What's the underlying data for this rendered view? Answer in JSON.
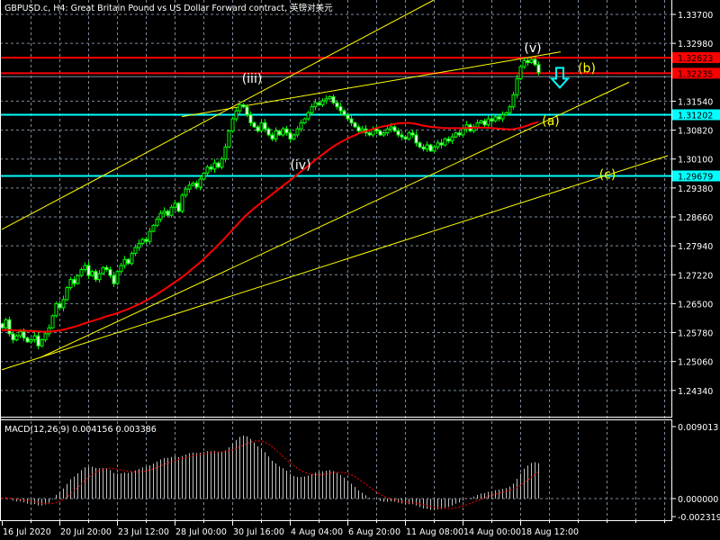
{
  "title": "GBPUSD.c, H4:  Great Britain Pound vs US Dollar Forward contract, 英镑对美元",
  "colors": {
    "background": "#000000",
    "bull": "#00ff00",
    "ma": "#ff0000",
    "trend": "#ffff00",
    "support": "#00ffff",
    "resistance": "#ff0000",
    "grid": "#7a8a9a",
    "macd_hist": "#c0c0c0",
    "macd_signal": "#ff0000"
  },
  "chart_data": {
    "type": "candlestick",
    "symbol": "GBPUSD.c",
    "timeframe": "H4",
    "ylim": [
      1.23687,
      1.34058
    ],
    "y_ticks": [
      "1.33700",
      "1.32980",
      "1.31540",
      "1.30820",
      "1.30100",
      "1.29380",
      "1.28660",
      "1.27940",
      "1.27220",
      "1.26500",
      "1.25780",
      "1.25060",
      "1.24340"
    ],
    "x_ticks": [
      {
        "bar": 0,
        "label": "16 Jul 2020"
      },
      {
        "bar": 16,
        "label": "20 Jul 20:00"
      },
      {
        "bar": 32,
        "label": "23 Jul 12:00"
      },
      {
        "bar": 48,
        "label": "28 Jul 00:00"
      },
      {
        "bar": 64,
        "label": "30 Jul 16:00"
      },
      {
        "bar": 80,
        "label": "4 Aug 04:00"
      },
      {
        "bar": 96,
        "label": "6 Aug 20:00"
      },
      {
        "bar": 112,
        "label": "11 Aug 08:00"
      },
      {
        "bar": 128,
        "label": "14 Aug 00:00"
      },
      {
        "bar": 144,
        "label": "18 Aug 12:00"
      }
    ],
    "closes": [
      1.259,
      1.261,
      1.2575,
      1.256,
      1.257,
      1.258,
      1.2565,
      1.2555,
      1.256,
      1.257,
      1.2545,
      1.256,
      1.2575,
      1.259,
      1.262,
      1.265,
      1.264,
      1.266,
      1.269,
      1.271,
      1.27,
      1.272,
      1.2735,
      1.2745,
      1.272,
      1.273,
      1.271,
      1.2725,
      1.274,
      1.2735,
      1.272,
      1.27,
      1.273,
      1.2745,
      1.276,
      1.275,
      1.2775,
      1.279,
      1.28,
      1.281,
      1.2805,
      1.283,
      1.2845,
      1.286,
      1.2875,
      1.288,
      1.287,
      1.289,
      1.29,
      1.288,
      1.292,
      1.2935,
      1.2945,
      1.295,
      1.294,
      1.296,
      1.2975,
      1.299,
      1.2985,
      1.3,
      1.299,
      1.301,
      1.304,
      1.308,
      1.311,
      1.313,
      1.3145,
      1.314,
      1.312,
      1.31,
      1.309,
      1.308,
      1.31,
      1.3085,
      1.307,
      1.306,
      1.308,
      1.307,
      1.3085,
      1.3075,
      1.306,
      1.307,
      1.3085,
      1.31,
      1.311,
      1.3125,
      1.314,
      1.315,
      1.3145,
      1.3155,
      1.316,
      1.3165,
      1.315,
      1.314,
      1.313,
      1.312,
      1.311,
      1.31,
      1.309,
      1.308,
      1.3085,
      1.3075,
      1.307,
      1.3085,
      1.308,
      1.307,
      1.3075,
      1.3085,
      1.309,
      1.308,
      1.307,
      1.3065,
      1.306,
      1.3075,
      1.307,
      1.305,
      1.304,
      1.3035,
      1.3045,
      1.303,
      1.304,
      1.305,
      1.3045,
      1.306,
      1.3055,
      1.3065,
      1.3075,
      1.307,
      1.3085,
      1.3095,
      1.308,
      1.309,
      1.31,
      1.3105,
      1.3095,
      1.311,
      1.3105,
      1.3115,
      1.311,
      1.312,
      1.3125,
      1.314,
      1.317,
      1.321,
      1.324,
      1.3255,
      1.325,
      1.3258,
      1.3245,
      1.3225
    ],
    "moving_average": {
      "type": "SMA",
      "period": 50
    },
    "horizontal_lines": [
      {
        "price": 1.32623,
        "label": "1.32623",
        "color": "#ff0000"
      },
      {
        "price": 1.32235,
        "label": "1.32235",
        "color": "#ff0000"
      },
      {
        "price": 1.31202,
        "label": "1.31202",
        "color": "#00ffff"
      },
      {
        "price": 1.29679,
        "label": "1.29679",
        "color": "#00ffff"
      }
    ],
    "trendlines": [
      {
        "b1": 0,
        "p1": 1.28348,
        "b2": 120,
        "p2": 1.34058
      },
      {
        "b1": 10.75,
        "p1": 1.2516,
        "b2": 174.25,
        "p2": 1.32011
      },
      {
        "b1": 0,
        "p1": 1.24854,
        "b2": 185,
        "p2": 1.30183
      },
      {
        "b1": 50,
        "p1": 1.31154,
        "b2": 155.25,
        "p2": 1.32766
      }
    ],
    "wave_labels": [
      {
        "text": "(iii)",
        "bar": 69.5,
        "price": 1.32,
        "color": "#ffffff"
      },
      {
        "text": "(iv)",
        "bar": 83,
        "price": 1.2985,
        "color": "#ffffff"
      },
      {
        "text": "(v)",
        "bar": 147.5,
        "price": 1.3276,
        "color": "#ffffff"
      },
      {
        "text": "(b)",
        "bar": 162.5,
        "price": 1.3225,
        "color": "#ffff00"
      },
      {
        "text": "(a)",
        "bar": 152.5,
        "price": 1.3094,
        "color": "#ffff00"
      },
      {
        "text": "(c)",
        "bar": 168.25,
        "price": 1.2961,
        "color": "#ffff00"
      }
    ],
    "arrow": {
      "bar": 155,
      "price": 1.321,
      "direction": "down",
      "color": "#00ffff"
    },
    "indicator": {
      "label": "MACD(12,26,9) 0.004156 0.003386",
      "ylim": [
        -0.002319,
        0.009013
      ],
      "y_ticks": [
        "0.009013",
        "0.000000",
        "-0.002319"
      ],
      "fast": 12,
      "slow": 26,
      "signal": 9
    }
  }
}
